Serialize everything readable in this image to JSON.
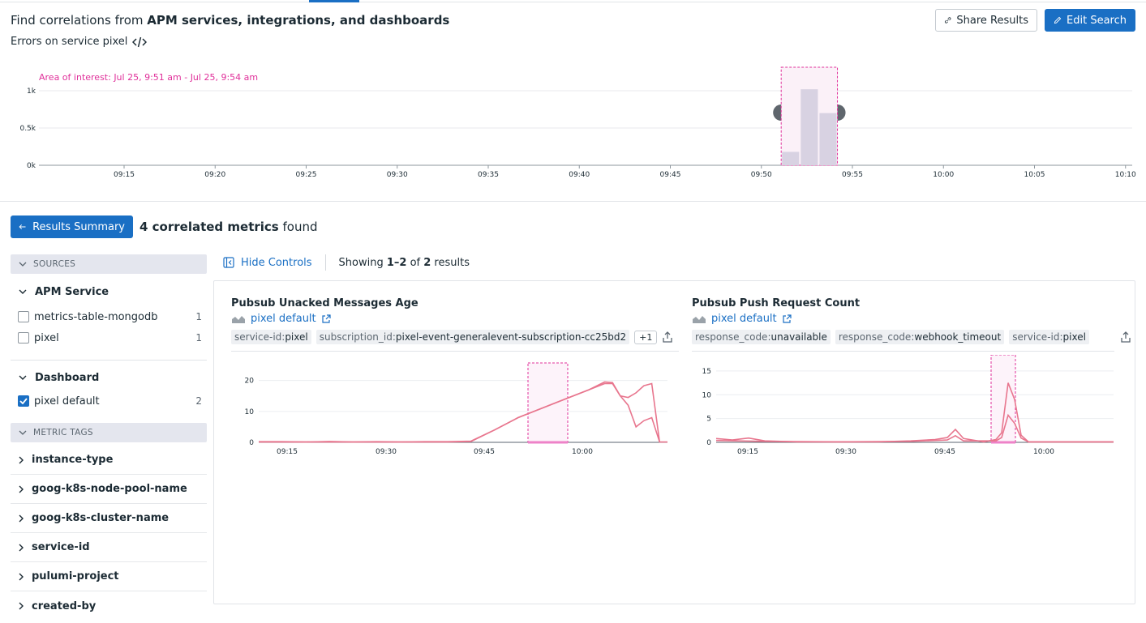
{
  "header": {
    "title_prefix": "Find correlations from ",
    "title_bold": "APM services, integrations, and dashboards",
    "subtitle": "Errors on service pixel",
    "share_label": "Share Results",
    "edit_label": "Edit Search"
  },
  "timeline": {
    "aoi_label": "Area of interest: Jul 25, 9:51 am - Jul 25, 9:54 am",
    "y_ticks": [
      "1k",
      "0.5k",
      "0k"
    ],
    "x_ticks": [
      "09:15",
      "09:20",
      "09:25",
      "09:30",
      "09:35",
      "09:40",
      "09:45",
      "09:50",
      "09:55",
      "10:00",
      "10:05",
      "10:10"
    ],
    "bars": [
      {
        "time": "09:51",
        "value": 180
      },
      {
        "time": "09:52",
        "value": 1020
      },
      {
        "time": "09:53",
        "value": 700
      }
    ],
    "colors": {
      "bar": "#d8d2e2",
      "aoi": "#e0309a",
      "handle": "#5f666d"
    }
  },
  "results": {
    "back_label": "Results Summary",
    "count_bold": "4 correlated metrics",
    "count_suffix": " found",
    "hide_controls": "Hide Controls",
    "showing_prefix": "Showing ",
    "showing_range": "1–2",
    "showing_mid": " of ",
    "showing_total": "2",
    "showing_suffix": " results"
  },
  "sidebar": {
    "sources_label": "SOURCES",
    "apm_title": "APM Service",
    "apm_items": [
      {
        "label": "metrics-table-mongodb",
        "count": "1",
        "checked": false
      },
      {
        "label": "pixel",
        "count": "1",
        "checked": false
      }
    ],
    "dashboard_title": "Dashboard",
    "dashboard_items": [
      {
        "label": "pixel default",
        "count": "2",
        "checked": true
      }
    ],
    "metric_tags_label": "METRIC TAGS",
    "tags": [
      "instance-type",
      "goog-k8s-node-pool-name",
      "goog-k8s-cluster-name",
      "service-id",
      "pulumi-project",
      "created-by"
    ]
  },
  "cards": [
    {
      "title": "Pubsub Unacked Messages Age",
      "source": "pixel default",
      "tags": [
        {
          "k": "service-id:",
          "v": "pixel"
        },
        {
          "k": "subscription_id:",
          "v": "pixel-event-generalevent-subscription-cc25bd2"
        }
      ],
      "extra": "+1",
      "chart_data": {
        "type": "line",
        "y_ticks": [
          "20",
          "10",
          "0"
        ],
        "x_ticks": [
          "09:15",
          "09:30",
          "09:45",
          "10:00"
        ],
        "ylim": [
          0,
          22
        ],
        "series": [
          {
            "values_desc": "ramp",
            "points": [
              [
                0,
                0.2
              ],
              [
                30,
                0.2
              ],
              [
                60,
                0.1
              ],
              [
                90,
                0.3
              ],
              [
                120,
                0.1
              ],
              [
                150,
                0.2
              ],
              [
                180,
                0.1
              ],
              [
                210,
                0.2
              ],
              [
                240,
                0.2
              ],
              [
                270,
                0.4
              ],
              [
                300,
                4
              ],
              [
                330,
                8
              ],
              [
                360,
                11
              ],
              [
                390,
                14
              ],
              [
                420,
                17
              ],
              [
                440,
                19.5
              ],
              [
                450,
                19.3
              ],
              [
                460,
                15
              ],
              [
                470,
                14.5
              ],
              [
                480,
                16
              ],
              [
                490,
                18.3
              ],
              [
                500,
                19
              ],
              [
                510,
                0
              ]
            ]
          },
          {
            "values_desc": "lower",
            "points": [
              [
                0,
                0.1
              ],
              [
                240,
                0.1
              ],
              [
                270,
                0.3
              ],
              [
                300,
                4
              ],
              [
                330,
                8
              ],
              [
                360,
                11
              ],
              [
                390,
                14
              ],
              [
                420,
                17
              ],
              [
                440,
                19
              ],
              [
                450,
                19
              ],
              [
                460,
                15
              ],
              [
                470,
                12
              ],
              [
                480,
                5
              ],
              [
                490,
                7
              ],
              [
                500,
                8
              ],
              [
                510,
                0.1
              ],
              [
                520,
                0.1
              ]
            ]
          }
        ]
      }
    },
    {
      "title": "Pubsub Push Request Count",
      "source": "pixel default",
      "tags": [
        {
          "k": "response_code:",
          "v": "unavailable"
        },
        {
          "k": "response_code:",
          "v": "webhook_timeout"
        },
        {
          "k": "service-id:",
          "v": "pixel"
        }
      ],
      "extra": "",
      "chart_data": {
        "type": "line",
        "y_ticks": [
          "15",
          "10",
          "5",
          "0"
        ],
        "x_ticks": [
          "09:15",
          "09:30",
          "09:45",
          "10:00"
        ],
        "ylim": [
          0,
          16
        ],
        "series": [
          {
            "values_desc": "peak",
            "points": [
              [
                0,
                0.8
              ],
              [
                20,
                0.5
              ],
              [
                40,
                0.9
              ],
              [
                60,
                0.3
              ],
              [
                100,
                0.1
              ],
              [
                150,
                0.1
              ],
              [
                200,
                0.1
              ],
              [
                240,
                0.3
              ],
              [
                270,
                0.6
              ],
              [
                285,
                1
              ],
              [
                295,
                2.7
              ],
              [
                305,
                0.8
              ],
              [
                330,
                0.1
              ],
              [
                345,
                0.6
              ],
              [
                352,
                2
              ],
              [
                360,
                12.5
              ],
              [
                368,
                9
              ],
              [
                376,
                1.5
              ],
              [
                385,
                0.1
              ],
              [
                440,
                0.1
              ],
              [
                470,
                0.1
              ],
              [
                490,
                0.1
              ]
            ]
          },
          {
            "values_desc": "minor",
            "points": [
              [
                0,
                0.4
              ],
              [
                60,
                0.2
              ],
              [
                150,
                0.1
              ],
              [
                240,
                0.2
              ],
              [
                285,
                0.5
              ],
              [
                295,
                1.4
              ],
              [
                305,
                0.3
              ],
              [
                345,
                0.3
              ],
              [
                352,
                1
              ],
              [
                360,
                5.7
              ],
              [
                368,
                4
              ],
              [
                376,
                0.9
              ],
              [
                385,
                0.1
              ],
              [
                490,
                0.1
              ]
            ]
          }
        ]
      }
    }
  ],
  "colors": {
    "accent": "#1a6fc4",
    "series": "#e8768e",
    "aoi": "#e0309a"
  }
}
